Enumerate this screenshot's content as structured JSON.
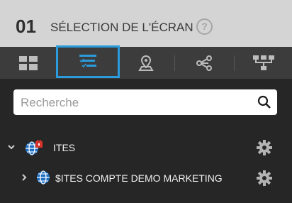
{
  "header": {
    "step": "01",
    "title": "SÉLECTION DE L'ÉCRAN",
    "help_symbol": "?"
  },
  "toolbar": {
    "tabs": [
      {
        "icon": "grid-icon",
        "selected": false
      },
      {
        "icon": "checklist-filter-icon",
        "selected": true
      },
      {
        "icon": "map-pin-icon",
        "selected": false
      },
      {
        "icon": "share-nodes-icon",
        "selected": false
      },
      {
        "icon": "hierarchy-icon",
        "selected": false
      }
    ]
  },
  "search": {
    "placeholder": "Recherche",
    "value": ""
  },
  "tree": [
    {
      "label": "ITES",
      "expanded": true,
      "locked": true
    },
    {
      "label": "$ITES COMPTE DEMO MARKETING",
      "expanded": false,
      "locked": false
    }
  ],
  "colors": {
    "accent": "#2a9bdc",
    "header_bg": "#d4d4d4",
    "toolbar_bg": "#3c3c3c",
    "body_bg": "#262626",
    "lock": "#d9342b"
  }
}
